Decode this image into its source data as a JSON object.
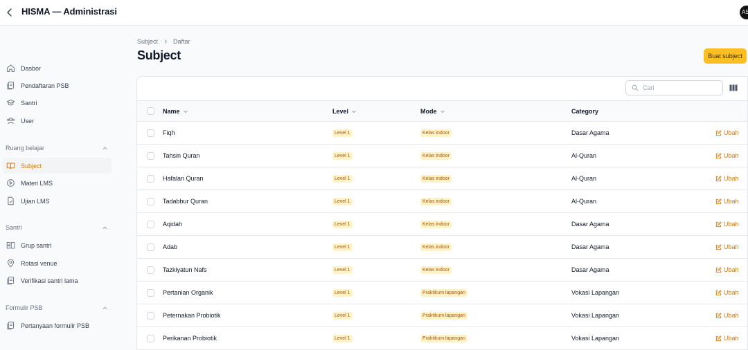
{
  "header": {
    "title": "HISMA — Administrasi",
    "avatar_initials": "AS"
  },
  "sidebar": {
    "top_items": [
      {
        "label": "Dasbor",
        "icon": "home-icon"
      },
      {
        "label": "Pendaftaran PSB",
        "icon": "documents-icon"
      },
      {
        "label": "Santri",
        "icon": "graduation-cap-icon"
      },
      {
        "label": "User",
        "icon": "users-icon"
      }
    ],
    "groups": [
      {
        "label": "Ruang belajar",
        "items": [
          {
            "label": "Subject",
            "icon": "book-open-icon",
            "active": true
          },
          {
            "label": "Materi LMS",
            "icon": "play-circle-icon"
          },
          {
            "label": "Ujian LMS",
            "icon": "document-check-icon"
          }
        ]
      },
      {
        "label": "Santri",
        "items": [
          {
            "label": "Grup santri",
            "icon": "grid-icon"
          },
          {
            "label": "Rotasi venue",
            "icon": "map-pin-icon"
          },
          {
            "label": "Verifikasi santri lama",
            "icon": "documents-icon"
          }
        ]
      },
      {
        "label": "Formulir PSB",
        "items": [
          {
            "label": "Pertanyaan formulir PSB",
            "icon": "documents-icon"
          }
        ]
      }
    ]
  },
  "breadcrumb": {
    "parent": "Subject",
    "current": "Daftar"
  },
  "page": {
    "title": "Subject",
    "create_button": "Buat subject"
  },
  "table": {
    "search_placeholder": "Cari",
    "columns": {
      "name": "Name",
      "level": "Level",
      "mode": "Mode",
      "category": "Category"
    },
    "edit_label": "Ubah",
    "rows": [
      {
        "name": "Fiqh",
        "level": "Level 1",
        "mode": "Kelas indoor",
        "category": "Dasar Agama"
      },
      {
        "name": "Tahsin Quran",
        "level": "Level 1",
        "mode": "Kelas indoor",
        "category": "Al-Quran"
      },
      {
        "name": "Hafalan Quran",
        "level": "Level 1",
        "mode": "Kelas indoor",
        "category": "Al-Quran"
      },
      {
        "name": "Tadabbur Quran",
        "level": "Level 1",
        "mode": "Kelas indoor",
        "category": "Al-Quran"
      },
      {
        "name": "Aqidah",
        "level": "Level 1",
        "mode": "Kelas indoor",
        "category": "Dasar Agama"
      },
      {
        "name": "Adab",
        "level": "Level 1",
        "mode": "Kelas indoor",
        "category": "Dasar Agama"
      },
      {
        "name": "Tazkiyatun Nafs",
        "level": "Level 1",
        "mode": "Kelas indoor",
        "category": "Dasar Agama"
      },
      {
        "name": "Pertanian Organik",
        "level": "Level 1",
        "mode": "Praktikum lapangan",
        "category": "Vokasi Lapangan"
      },
      {
        "name": "Peternakan Probiotik",
        "level": "Level 1",
        "mode": "Praktikum lapangan",
        "category": "Vokasi Lapangan"
      },
      {
        "name": "Perikanan Probiotik",
        "level": "Level 1",
        "mode": "Praktikum lapangan",
        "category": "Vokasi Lapangan"
      }
    ]
  },
  "colors": {
    "accent": "#fbbf24",
    "accent_text": "#d97706",
    "badge_bg": "#fef3c7"
  }
}
